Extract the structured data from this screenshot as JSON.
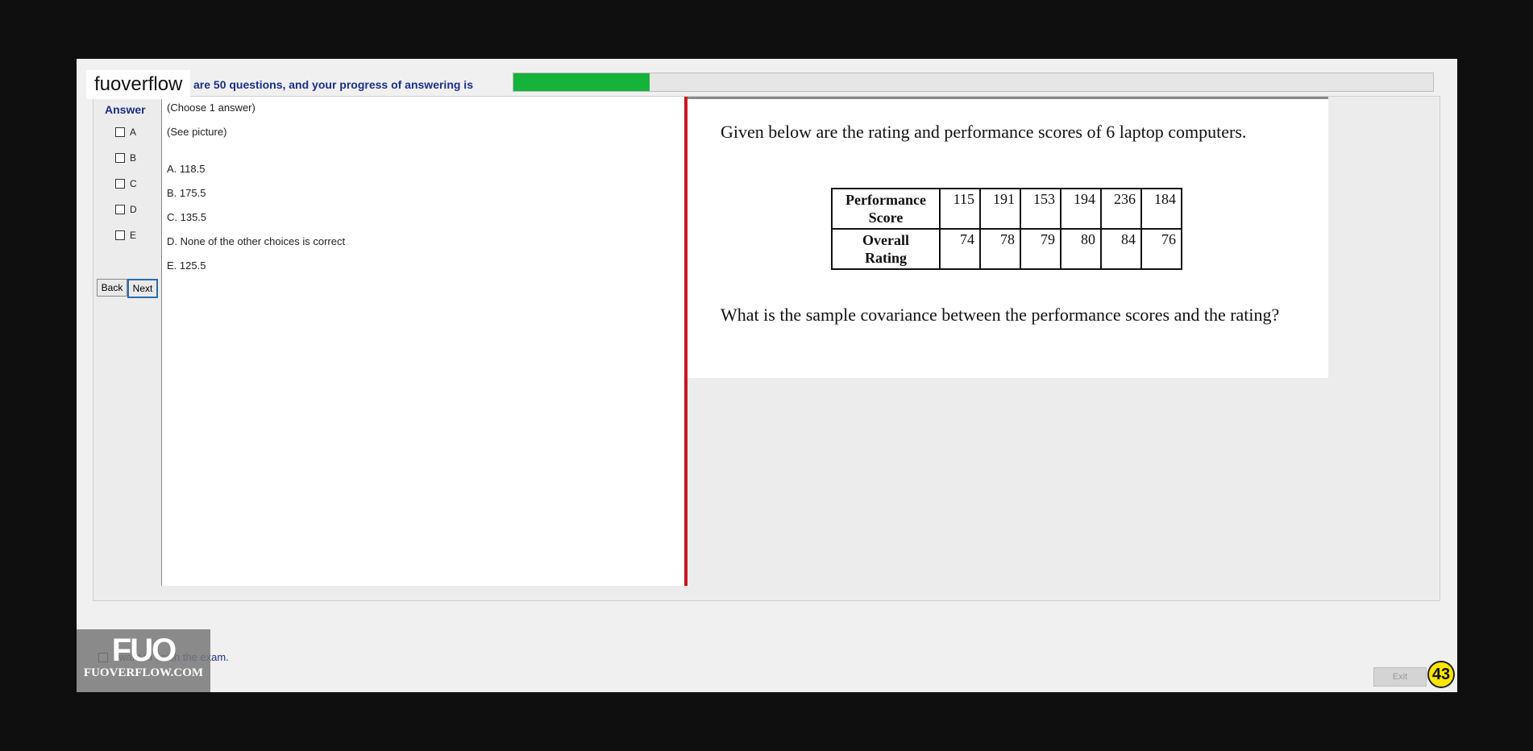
{
  "brand_tag": "fuoverflow",
  "progress": {
    "text": "are 50 questions, and your progress of answering is",
    "fraction": 0.148
  },
  "answer": {
    "title": "Answer",
    "options": [
      "A",
      "B",
      "C",
      "D",
      "E"
    ],
    "back_label": "Back",
    "next_label": "Next"
  },
  "question": {
    "instruction": "(Choose 1 answer)",
    "see_picture": "(See picture)",
    "choices": [
      "A.  118.5",
      "B.  175.5",
      "C.  135.5",
      "D.  None of the other choices is correct",
      "E.  125.5"
    ]
  },
  "picture": {
    "intro": "Given below are the rating and performance scores of 6 laptop computers.",
    "table": {
      "row1_label": [
        "Performance",
        "Score"
      ],
      "row1_values": [
        "115",
        "191",
        "153",
        "194",
        "236",
        "184"
      ],
      "row2_label": [
        "Overall",
        "Rating"
      ],
      "row2_values": [
        "74",
        "78",
        "79",
        "80",
        "84",
        "76"
      ]
    },
    "question_text": "What is the sample covariance between the performance scores and the rating?"
  },
  "footer": {
    "finish_text": "I want to finish the exam.",
    "logo_big": "FUO",
    "logo_small": "FUOVERFLOW.COM",
    "exit_label": "Exit",
    "page_number": "43"
  },
  "colors": {
    "progress": "#16b33a",
    "divider": "#c8171f",
    "badge": "#ffe500"
  }
}
